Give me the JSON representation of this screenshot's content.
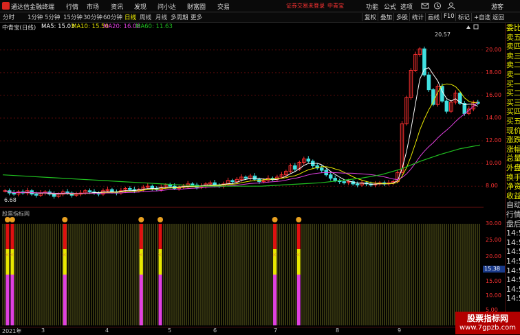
{
  "window": {
    "app_name": "通达信金融终端",
    "menus": [
      "行情",
      "市场",
      "资讯",
      "发现",
      "问小达",
      "财富圈",
      "交易"
    ],
    "warning": "证券交易未登录",
    "stock_name_top": "中青宝",
    "right_menus": [
      "功能",
      "公式",
      "选项"
    ],
    "user": "游客"
  },
  "toolbar": {
    "periods": [
      "分时",
      "1分钟",
      "5分钟",
      "15分钟",
      "30分钟",
      "60分钟",
      "日线",
      "周线",
      "月线",
      "多周期",
      "更多"
    ],
    "active_period": "日线",
    "right_buttons": [
      "复权",
      "叠加",
      "多股",
      "统计",
      "画线",
      "F10",
      "标记",
      "+自选",
      "返回"
    ]
  },
  "info": {
    "title": "中青宝(日线)",
    "ma5": "MA5: 15.03",
    "ma10": "MA10: 15.50",
    "ma20": "MA20: 16.08",
    "ma60": "MA60: 11.63"
  },
  "colors": {
    "ma5": "#ffffff",
    "ma10": "#e8e800",
    "ma20": "#e040e0",
    "ma60": "#20c020",
    "up": "#ff3030",
    "down": "#40e0e0",
    "grid": "#5a0a0a"
  },
  "price_axis": {
    "ticks": [
      "20.00",
      "18.00",
      "16.00",
      "14.00",
      "12.00",
      "10.00",
      "8.00"
    ],
    "values": [
      20,
      18,
      16,
      14,
      12,
      10,
      8
    ],
    "min": 6.5,
    "max": 21.5
  },
  "price_annotations": {
    "high": "20.57",
    "low": "6.68"
  },
  "indicator": {
    "title": "股票指标网",
    "ticks": [
      "30.00",
      "25.00",
      "20.00",
      "15.00",
      "10.00",
      "5.00"
    ],
    "current": "15.38"
  },
  "x_axis": {
    "labels": [
      "2021年",
      "3",
      "4",
      "5",
      "6",
      "7",
      "8",
      "9"
    ]
  },
  "sidepanel": {
    "items": [
      "委比",
      "卖五",
      "卖四",
      "卖三",
      "卖二",
      "卖一",
      "买一",
      "买二",
      "买三",
      "买四",
      "买五",
      "现价",
      "涨跌",
      "涨幅",
      "总量",
      "外盘",
      "换手",
      "净资",
      "收益",
      "自动",
      "行情",
      "盘后",
      "14:5",
      "14:5",
      "14:5",
      "14:5",
      "14:5",
      "14:5",
      "14:5",
      "14:5"
    ]
  },
  "watermark": {
    "line1": "股票指标网",
    "line2": "www.7gpzb.com"
  },
  "chart_data": {
    "type": "candlestick",
    "title": "中青宝(日线)",
    "close_series": [
      7.6,
      7.4,
      7.3,
      7.5,
      7.4,
      7.6,
      7.3,
      7.2,
      7.4,
      7.5,
      7.3,
      7.1,
      7.3,
      7.5,
      7.4,
      7.2,
      7.3,
      7.4,
      7.6,
      7.5,
      7.4,
      7.3,
      7.6,
      7.7,
      7.5,
      7.4,
      7.6,
      7.8,
      7.7,
      7.6,
      7.7,
      7.9,
      8.0,
      7.8,
      7.7,
      7.9,
      8.1,
      8.0,
      7.8,
      7.9,
      8.0,
      8.2,
      8.1,
      7.9,
      8.0,
      8.2,
      8.3,
      8.1,
      8.0,
      8.2,
      8.5,
      8.4,
      8.6,
      8.8,
      8.7,
      8.9,
      8.6,
      8.4,
      8.5,
      8.7,
      8.6,
      8.8,
      9.0,
      9.3,
      9.8,
      9.5,
      10.1,
      10.4,
      10.2,
      9.8,
      9.6,
      9.4,
      9.0,
      8.7,
      8.5,
      8.4,
      8.3,
      8.4,
      8.2,
      8.1,
      8.3,
      8.2,
      8.1,
      8.2,
      8.3,
      8.2,
      8.3,
      8.4,
      9.2,
      13.5,
      15.8,
      18.2,
      19.6,
      20.1,
      17.8,
      16.5,
      15.2,
      16.8,
      15.5,
      14.6,
      15.4,
      16.2,
      15.3,
      14.4,
      14.8,
      15.4,
      15.3
    ],
    "ma60": [
      9.0,
      8.9,
      8.8,
      8.7,
      8.6,
      8.5,
      8.4,
      8.3,
      8.2,
      8.1,
      8.0,
      8.0,
      8.0,
      8.0,
      8.1,
      8.2,
      8.3,
      8.5,
      8.7,
      9.0,
      9.5,
      10.2,
      10.8,
      11.3,
      11.63
    ],
    "ylim": [
      6.5,
      21.5
    ],
    "high_label": 20.57,
    "low_label": 6.68,
    "indicator_signals_x_fraction": [
      0.01,
      0.02,
      0.13,
      0.29,
      0.33,
      0.57,
      0.62
    ]
  }
}
